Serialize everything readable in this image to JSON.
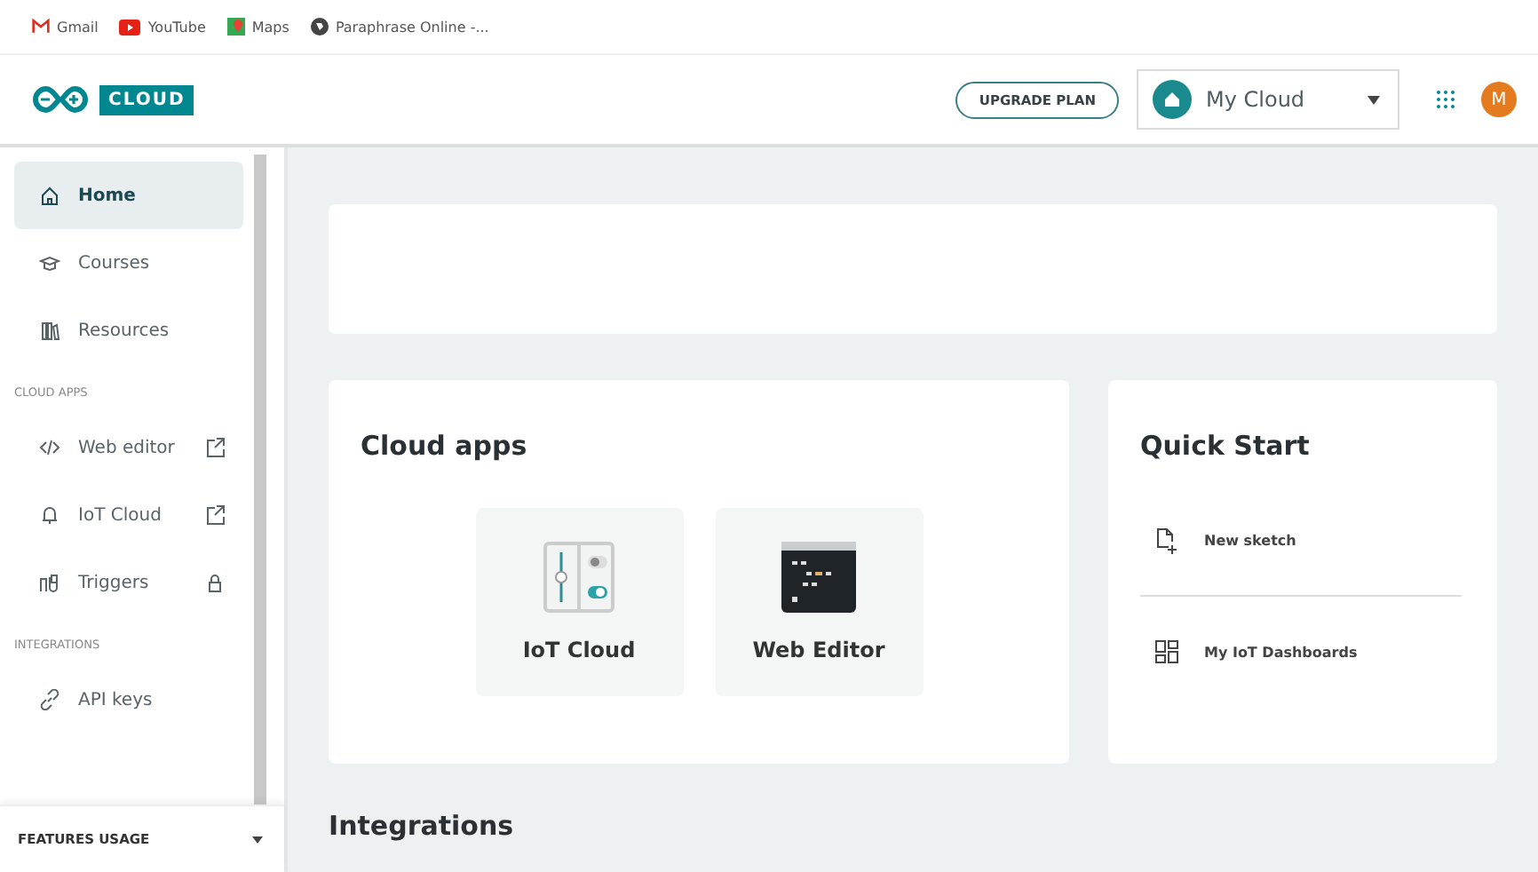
{
  "bookmarks": [
    {
      "label": "Gmail"
    },
    {
      "label": "YouTube"
    },
    {
      "label": "Maps"
    },
    {
      "label": "Paraphrase Online -..."
    }
  ],
  "header": {
    "logo": "CLOUD",
    "upgrade": "UPGRADE PLAN",
    "space": "My Cloud",
    "avatar": "M"
  },
  "sidebar": {
    "sections": [
      {
        "items": [
          {
            "label": "Home",
            "selected": true,
            "kind": "plain"
          },
          {
            "label": "Courses",
            "selected": false,
            "kind": "plain"
          },
          {
            "label": "Resources",
            "selected": false,
            "kind": "plain"
          }
        ]
      },
      {
        "label": "CLOUD APPS",
        "items": [
          {
            "label": "Web editor",
            "selected": false,
            "kind": "external"
          },
          {
            "label": "IoT Cloud",
            "selected": false,
            "kind": "external"
          },
          {
            "label": "Triggers",
            "selected": false,
            "kind": "locked"
          }
        ]
      },
      {
        "label": "INTEGRATIONS",
        "items": [
          {
            "label": "API keys",
            "selected": false,
            "kind": "plain"
          }
        ]
      }
    ],
    "footer": "FEATURES USAGE"
  },
  "cloud_apps": {
    "title": "Cloud apps",
    "apps": [
      {
        "label": "IoT Cloud",
        "kind": "iot"
      },
      {
        "label": "Web Editor",
        "kind": "editor"
      }
    ]
  },
  "quick_start": {
    "title": "Quick Start",
    "items": [
      {
        "label": "New sketch"
      },
      {
        "label": "My IoT Dashboards"
      }
    ]
  },
  "integrations": {
    "title": "Integrations"
  }
}
